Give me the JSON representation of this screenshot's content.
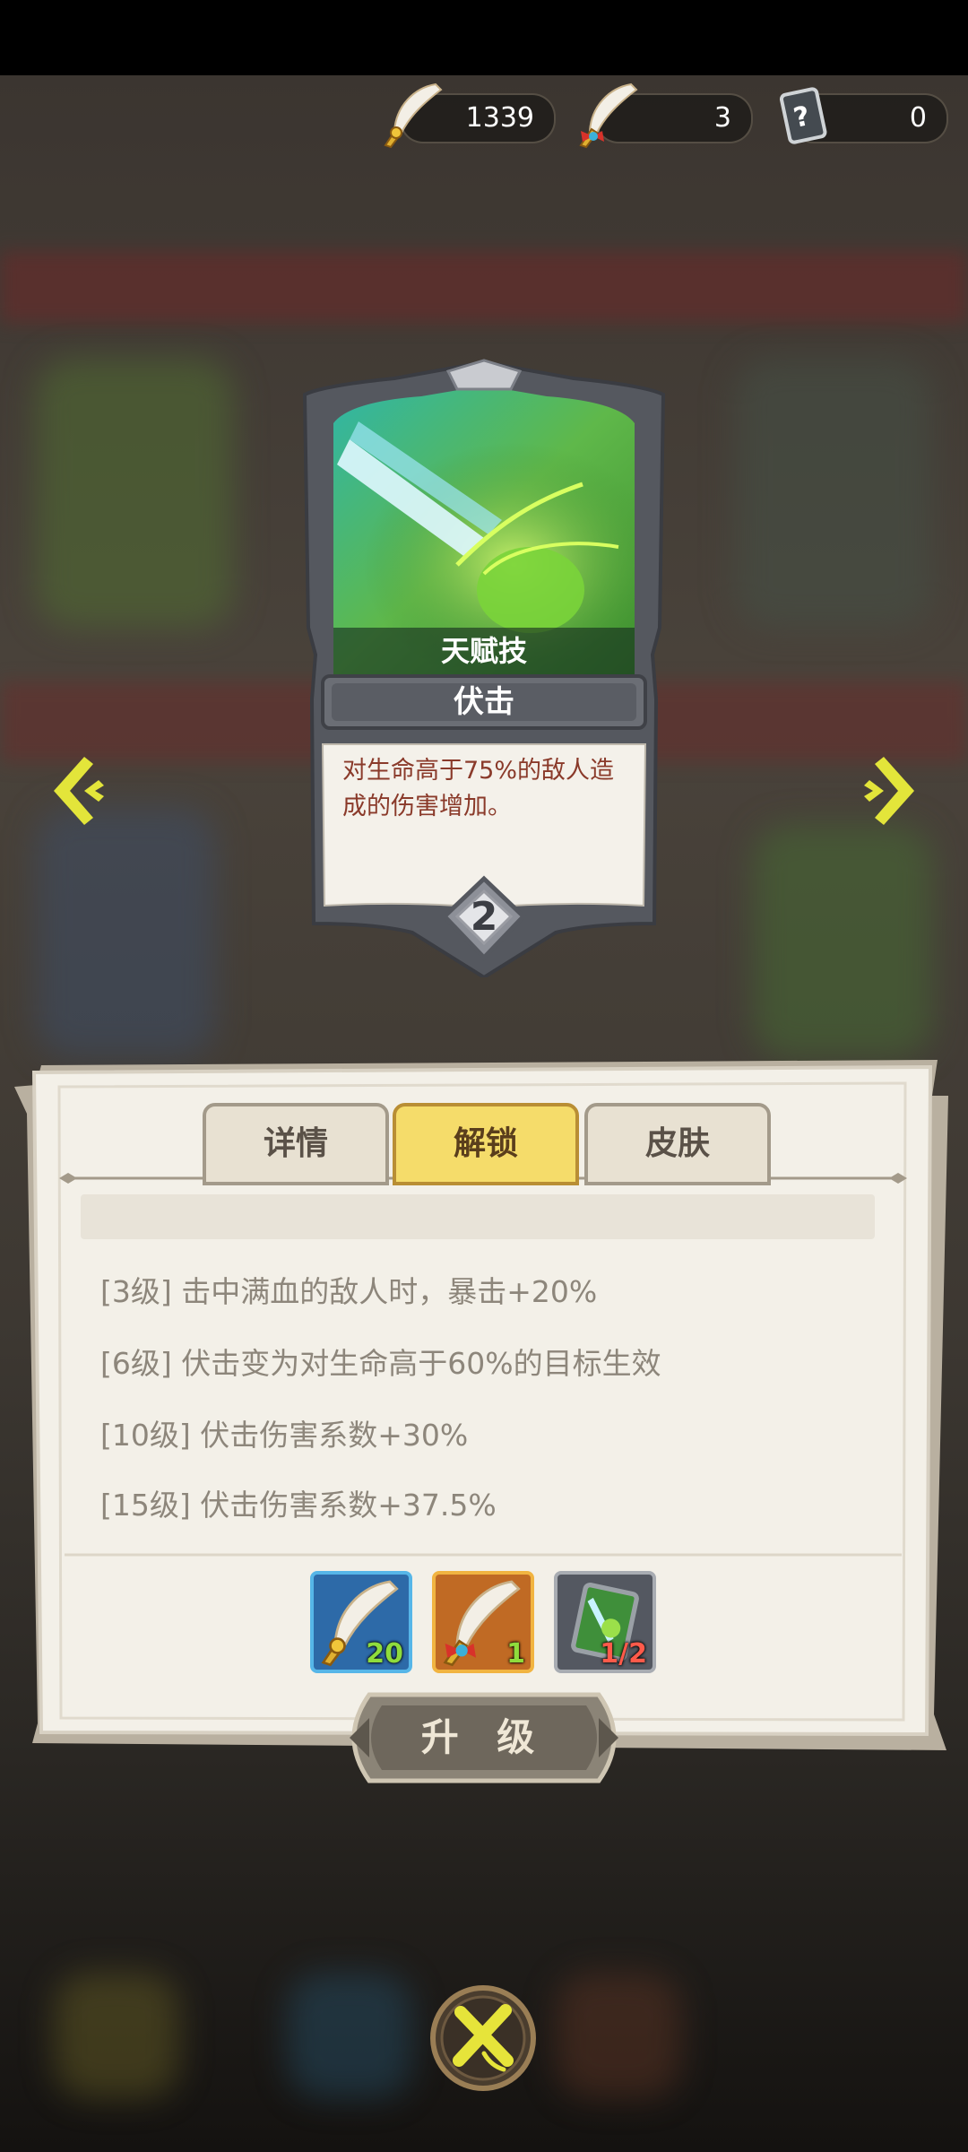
{
  "currency": {
    "feather_gold": "1339",
    "feather_red": "3",
    "mystery_card": "0"
  },
  "card": {
    "type_label": "天赋技",
    "skill_name": "伏击",
    "description_line1": "对生命高于75%的敌人造",
    "description_line2": "成的伤害增加。",
    "level": "2"
  },
  "tabs": [
    {
      "label": "详情",
      "active": false
    },
    {
      "label": "解锁",
      "active": true
    },
    {
      "label": "皮肤",
      "active": false
    }
  ],
  "unlocks": [
    "[3级]  击中满血的敌人时，暴击+20%",
    "[6级]  伏击变为对生命高于60%的目标生效",
    "[10级]  伏击伤害系数+30%",
    "[15级]  伏击伤害系数+37.5%"
  ],
  "requirements": [
    {
      "icon": "gold-feather-icon",
      "count": "20",
      "count_color": "#8fdc3c"
    },
    {
      "icon": "red-feather-icon",
      "count": "1",
      "count_color": "#8fdc3c"
    },
    {
      "icon": "skill-card-icon",
      "count": "1/2",
      "count_color": "#ff5a4a"
    }
  ],
  "upgrade_label": "升 级"
}
